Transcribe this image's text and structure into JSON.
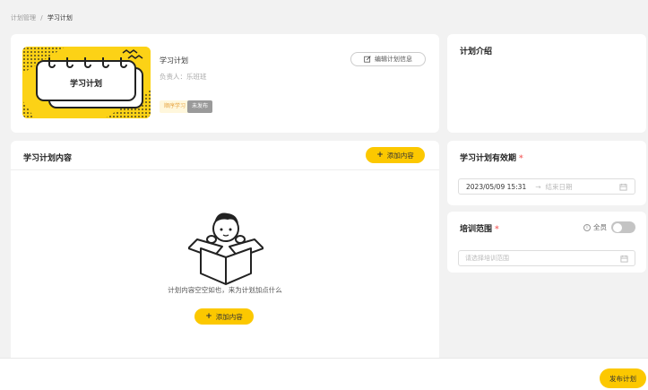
{
  "breadcrumb": {
    "parent": "计划管理",
    "separator": "/",
    "current": "学习计划"
  },
  "plan": {
    "cover_title": "学习计划",
    "name": "学习计划",
    "owner_label": "负责人：",
    "owner": "乐班班",
    "tags": {
      "order": "顺序学习",
      "status": "未发布"
    },
    "edit_label": "编辑计划信息",
    "edit_icon": "edit-icon"
  },
  "intro": {
    "title": "计划介绍"
  },
  "content": {
    "title": "学习计划内容",
    "add_label": "添加内容",
    "empty_text": "计划内容空空如也，来为计划加点什么"
  },
  "validity": {
    "title": "学习计划有效期",
    "required": "*",
    "start": "2023/05/09 15:31",
    "arrow": "→",
    "end_placeholder": "结束日期"
  },
  "scope": {
    "title": "培训范围",
    "required": "*",
    "all_label": "全员",
    "placeholder": "请选择培训范围"
  },
  "footer": {
    "publish_label": "发布计划"
  },
  "colors": {
    "accent": "#fcc800",
    "tag_status_bg": "#9a9a9a",
    "required": "#f56c6c"
  }
}
